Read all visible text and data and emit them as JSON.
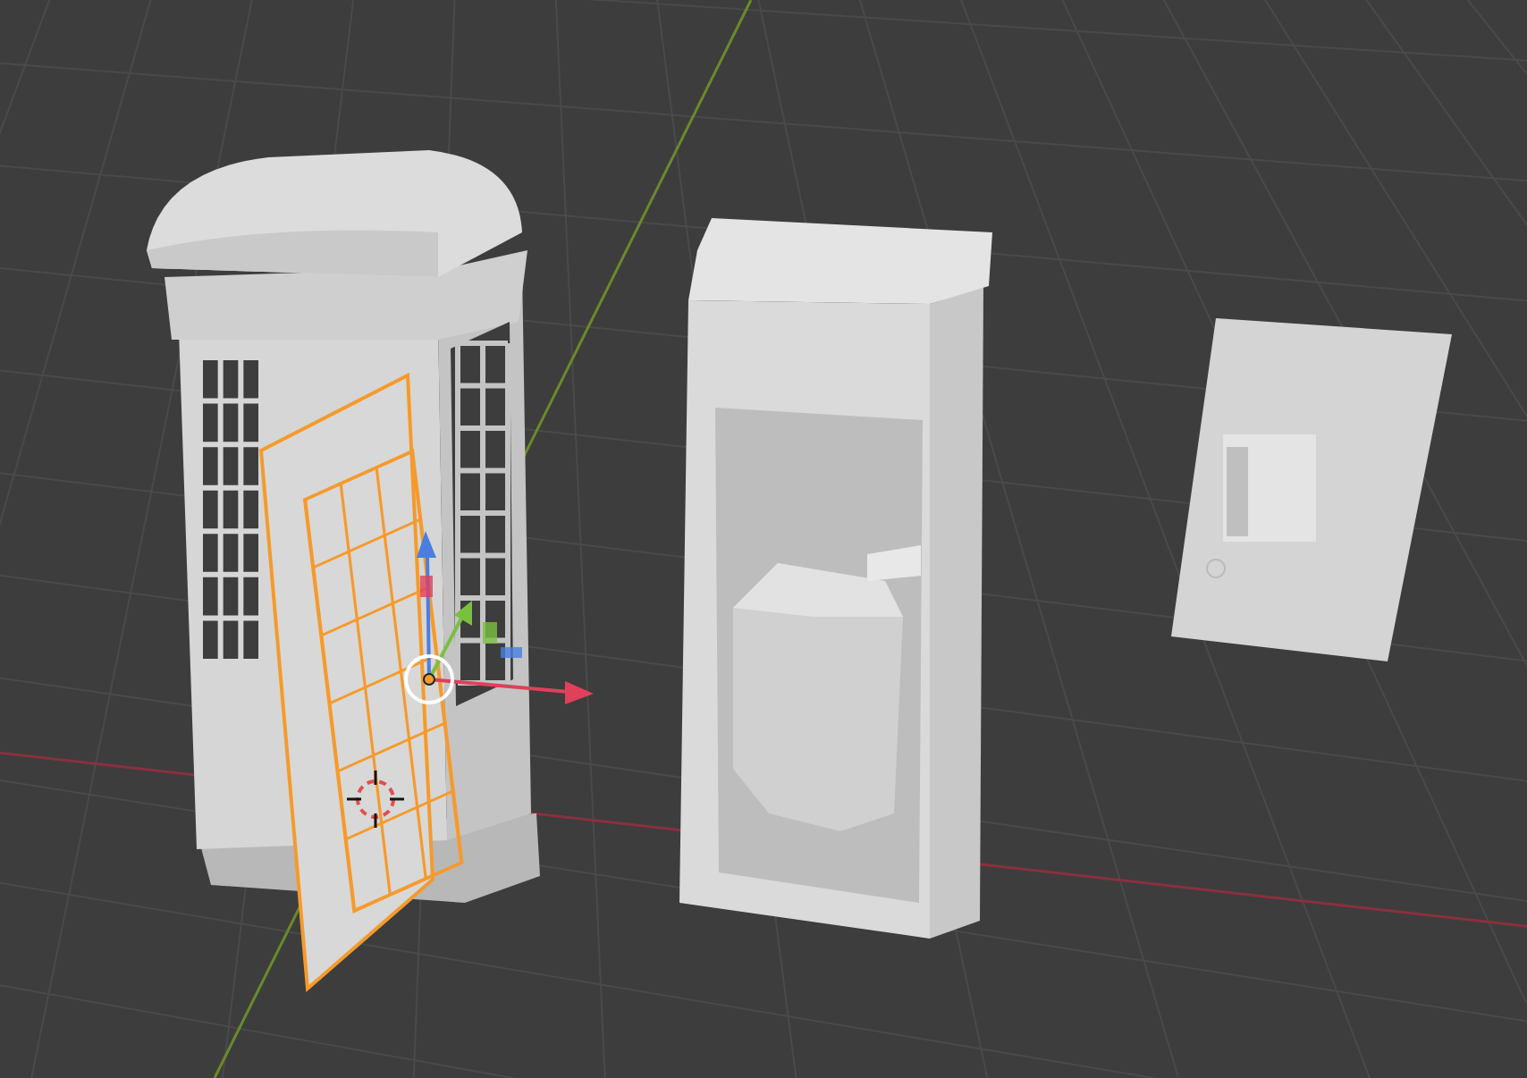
{
  "viewport": {
    "items": [
      {
        "kind": "booth",
        "selected": false
      },
      {
        "kind": "door",
        "selected": true
      },
      {
        "kind": "shell",
        "selected": false
      },
      {
        "kind": "panel",
        "selected": false
      },
      {
        "kind": "cursor",
        "selected": false
      }
    ]
  }
}
